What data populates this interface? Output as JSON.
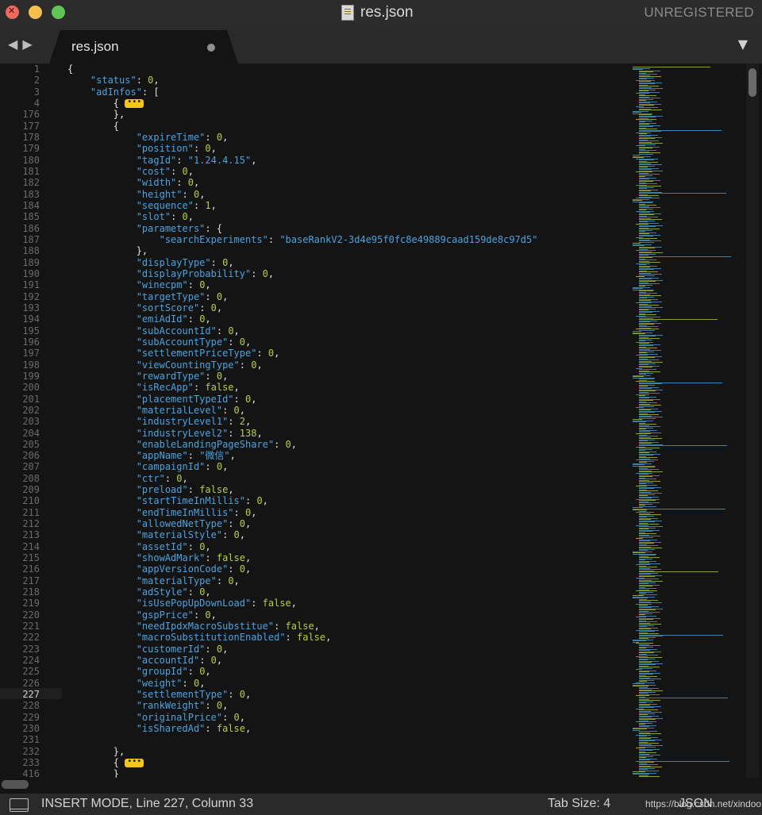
{
  "window": {
    "title": "res.json",
    "registration": "UNREGISTERED"
  },
  "tabs": [
    {
      "label": "res.json",
      "modified": true
    }
  ],
  "editor": {
    "current_line_number": 227,
    "lines": [
      {
        "n": 1,
        "indent": 0,
        "t": [
          [
            "p",
            "{"
          ]
        ]
      },
      {
        "n": 2,
        "indent": 1,
        "t": [
          [
            "k",
            "\"status\""
          ],
          [
            "p",
            ": "
          ],
          [
            "n",
            "0"
          ],
          [
            "p",
            ","
          ]
        ]
      },
      {
        "n": 3,
        "indent": 1,
        "t": [
          [
            "k",
            "\"adInfos\""
          ],
          [
            "p",
            ": ["
          ]
        ]
      },
      {
        "n": 4,
        "indent": 2,
        "t": [
          [
            "p",
            "{ "
          ],
          [
            "f",
            "•••"
          ]
        ]
      },
      {
        "n": 176,
        "indent": 2,
        "t": [
          [
            "p",
            "},"
          ]
        ]
      },
      {
        "n": 177,
        "indent": 2,
        "t": [
          [
            "p",
            "{"
          ]
        ]
      },
      {
        "n": 178,
        "indent": 3,
        "t": [
          [
            "k",
            "\"expireTime\""
          ],
          [
            "p",
            ": "
          ],
          [
            "n",
            "0"
          ],
          [
            "p",
            ","
          ]
        ]
      },
      {
        "n": 179,
        "indent": 3,
        "t": [
          [
            "k",
            "\"position\""
          ],
          [
            "p",
            ": "
          ],
          [
            "n",
            "0"
          ],
          [
            "p",
            ","
          ]
        ]
      },
      {
        "n": 180,
        "indent": 3,
        "t": [
          [
            "k",
            "\"tagId\""
          ],
          [
            "p",
            ": "
          ],
          [
            "s",
            "\"1.24.4.15\""
          ],
          [
            "p",
            ","
          ]
        ]
      },
      {
        "n": 181,
        "indent": 3,
        "t": [
          [
            "k",
            "\"cost\""
          ],
          [
            "p",
            ": "
          ],
          [
            "n",
            "0"
          ],
          [
            "p",
            ","
          ]
        ]
      },
      {
        "n": 182,
        "indent": 3,
        "t": [
          [
            "k",
            "\"width\""
          ],
          [
            "p",
            ": "
          ],
          [
            "n",
            "0"
          ],
          [
            "p",
            ","
          ]
        ]
      },
      {
        "n": 183,
        "indent": 3,
        "t": [
          [
            "k",
            "\"height\""
          ],
          [
            "p",
            ": "
          ],
          [
            "n",
            "0"
          ],
          [
            "p",
            ","
          ]
        ]
      },
      {
        "n": 184,
        "indent": 3,
        "t": [
          [
            "k",
            "\"sequence\""
          ],
          [
            "p",
            ": "
          ],
          [
            "n",
            "1"
          ],
          [
            "p",
            ","
          ]
        ]
      },
      {
        "n": 185,
        "indent": 3,
        "t": [
          [
            "k",
            "\"slot\""
          ],
          [
            "p",
            ": "
          ],
          [
            "n",
            "0"
          ],
          [
            "p",
            ","
          ]
        ]
      },
      {
        "n": 186,
        "indent": 3,
        "t": [
          [
            "k",
            "\"parameters\""
          ],
          [
            "p",
            ": {"
          ]
        ]
      },
      {
        "n": 187,
        "indent": 4,
        "t": [
          [
            "k",
            "\"searchExperiments\""
          ],
          [
            "p",
            ": "
          ],
          [
            "s",
            "\"baseRankV2-3d4e95f0fc8e49889caad159de8c97d5\""
          ]
        ]
      },
      {
        "n": 188,
        "indent": 3,
        "t": [
          [
            "p",
            "},"
          ]
        ]
      },
      {
        "n": 189,
        "indent": 3,
        "t": [
          [
            "k",
            "\"displayType\""
          ],
          [
            "p",
            ": "
          ],
          [
            "n",
            "0"
          ],
          [
            "p",
            ","
          ]
        ]
      },
      {
        "n": 190,
        "indent": 3,
        "t": [
          [
            "k",
            "\"displayProbability\""
          ],
          [
            "p",
            ": "
          ],
          [
            "n",
            "0"
          ],
          [
            "p",
            ","
          ]
        ]
      },
      {
        "n": 191,
        "indent": 3,
        "t": [
          [
            "k",
            "\"winecpm\""
          ],
          [
            "p",
            ": "
          ],
          [
            "n",
            "0"
          ],
          [
            "p",
            ","
          ]
        ]
      },
      {
        "n": 192,
        "indent": 3,
        "t": [
          [
            "k",
            "\"targetType\""
          ],
          [
            "p",
            ": "
          ],
          [
            "n",
            "0"
          ],
          [
            "p",
            ","
          ]
        ]
      },
      {
        "n": 193,
        "indent": 3,
        "t": [
          [
            "k",
            "\"sortScore\""
          ],
          [
            "p",
            ": "
          ],
          [
            "n",
            "0"
          ],
          [
            "p",
            ","
          ]
        ]
      },
      {
        "n": 194,
        "indent": 3,
        "t": [
          [
            "k",
            "\"emiAdId\""
          ],
          [
            "p",
            ": "
          ],
          [
            "n",
            "0"
          ],
          [
            "p",
            ","
          ]
        ]
      },
      {
        "n": 195,
        "indent": 3,
        "t": [
          [
            "k",
            "\"subAccountId\""
          ],
          [
            "p",
            ": "
          ],
          [
            "n",
            "0"
          ],
          [
            "p",
            ","
          ]
        ]
      },
      {
        "n": 196,
        "indent": 3,
        "t": [
          [
            "k",
            "\"subAccountType\""
          ],
          [
            "p",
            ": "
          ],
          [
            "n",
            "0"
          ],
          [
            "p",
            ","
          ]
        ]
      },
      {
        "n": 197,
        "indent": 3,
        "t": [
          [
            "k",
            "\"settlementPriceType\""
          ],
          [
            "p",
            ": "
          ],
          [
            "n",
            "0"
          ],
          [
            "p",
            ","
          ]
        ]
      },
      {
        "n": 198,
        "indent": 3,
        "t": [
          [
            "k",
            "\"viewCountingType\""
          ],
          [
            "p",
            ": "
          ],
          [
            "n",
            "0"
          ],
          [
            "p",
            ","
          ]
        ]
      },
      {
        "n": 199,
        "indent": 3,
        "t": [
          [
            "k",
            "\"rewardType\""
          ],
          [
            "p",
            ": "
          ],
          [
            "n",
            "0"
          ],
          [
            "p",
            ","
          ]
        ]
      },
      {
        "n": 200,
        "indent": 3,
        "t": [
          [
            "k",
            "\"isRecApp\""
          ],
          [
            "p",
            ": "
          ],
          [
            "b",
            "false"
          ],
          [
            "p",
            ","
          ]
        ]
      },
      {
        "n": 201,
        "indent": 3,
        "t": [
          [
            "k",
            "\"placementTypeId\""
          ],
          [
            "p",
            ": "
          ],
          [
            "n",
            "0"
          ],
          [
            "p",
            ","
          ]
        ]
      },
      {
        "n": 202,
        "indent": 3,
        "t": [
          [
            "k",
            "\"materialLevel\""
          ],
          [
            "p",
            ": "
          ],
          [
            "n",
            "0"
          ],
          [
            "p",
            ","
          ]
        ]
      },
      {
        "n": 203,
        "indent": 3,
        "t": [
          [
            "k",
            "\"industryLevel1\""
          ],
          [
            "p",
            ": "
          ],
          [
            "n",
            "2"
          ],
          [
            "p",
            ","
          ]
        ]
      },
      {
        "n": 204,
        "indent": 3,
        "t": [
          [
            "k",
            "\"industryLevel2\""
          ],
          [
            "p",
            ": "
          ],
          [
            "n",
            "138"
          ],
          [
            "p",
            ","
          ]
        ]
      },
      {
        "n": 205,
        "indent": 3,
        "t": [
          [
            "k",
            "\"enableLandingPageShare\""
          ],
          [
            "p",
            ": "
          ],
          [
            "n",
            "0"
          ],
          [
            "p",
            ","
          ]
        ]
      },
      {
        "n": 206,
        "indent": 3,
        "t": [
          [
            "k",
            "\"appName\""
          ],
          [
            "p",
            ": "
          ],
          [
            "s",
            "\"微信\""
          ],
          [
            "p",
            ","
          ]
        ]
      },
      {
        "n": 207,
        "indent": 3,
        "t": [
          [
            "k",
            "\"campaignId\""
          ],
          [
            "p",
            ": "
          ],
          [
            "n",
            "0"
          ],
          [
            "p",
            ","
          ]
        ]
      },
      {
        "n": 208,
        "indent": 3,
        "t": [
          [
            "k",
            "\"ctr\""
          ],
          [
            "p",
            ": "
          ],
          [
            "n",
            "0"
          ],
          [
            "p",
            ","
          ]
        ]
      },
      {
        "n": 209,
        "indent": 3,
        "t": [
          [
            "k",
            "\"preload\""
          ],
          [
            "p",
            ": "
          ],
          [
            "b",
            "false"
          ],
          [
            "p",
            ","
          ]
        ]
      },
      {
        "n": 210,
        "indent": 3,
        "t": [
          [
            "k",
            "\"startTimeInMillis\""
          ],
          [
            "p",
            ": "
          ],
          [
            "n",
            "0"
          ],
          [
            "p",
            ","
          ]
        ]
      },
      {
        "n": 211,
        "indent": 3,
        "t": [
          [
            "k",
            "\"endTimeInMillis\""
          ],
          [
            "p",
            ": "
          ],
          [
            "n",
            "0"
          ],
          [
            "p",
            ","
          ]
        ]
      },
      {
        "n": 212,
        "indent": 3,
        "t": [
          [
            "k",
            "\"allowedNetType\""
          ],
          [
            "p",
            ": "
          ],
          [
            "n",
            "0"
          ],
          [
            "p",
            ","
          ]
        ]
      },
      {
        "n": 213,
        "indent": 3,
        "t": [
          [
            "k",
            "\"materialStyle\""
          ],
          [
            "p",
            ": "
          ],
          [
            "n",
            "0"
          ],
          [
            "p",
            ","
          ]
        ]
      },
      {
        "n": 214,
        "indent": 3,
        "t": [
          [
            "k",
            "\"assetId\""
          ],
          [
            "p",
            ": "
          ],
          [
            "n",
            "0"
          ],
          [
            "p",
            ","
          ]
        ]
      },
      {
        "n": 215,
        "indent": 3,
        "t": [
          [
            "k",
            "\"showAdMark\""
          ],
          [
            "p",
            ": "
          ],
          [
            "b",
            "false"
          ],
          [
            "p",
            ","
          ]
        ]
      },
      {
        "n": 216,
        "indent": 3,
        "t": [
          [
            "k",
            "\"appVersionCode\""
          ],
          [
            "p",
            ": "
          ],
          [
            "n",
            "0"
          ],
          [
            "p",
            ","
          ]
        ]
      },
      {
        "n": 217,
        "indent": 3,
        "t": [
          [
            "k",
            "\"materialType\""
          ],
          [
            "p",
            ": "
          ],
          [
            "n",
            "0"
          ],
          [
            "p",
            ","
          ]
        ]
      },
      {
        "n": 218,
        "indent": 3,
        "t": [
          [
            "k",
            "\"adStyle\""
          ],
          [
            "p",
            ": "
          ],
          [
            "n",
            "0"
          ],
          [
            "p",
            ","
          ]
        ]
      },
      {
        "n": 219,
        "indent": 3,
        "t": [
          [
            "k",
            "\"isUsePopUpDownLoad\""
          ],
          [
            "p",
            ": "
          ],
          [
            "b",
            "false"
          ],
          [
            "p",
            ","
          ]
        ]
      },
      {
        "n": 220,
        "indent": 3,
        "t": [
          [
            "k",
            "\"gspPrice\""
          ],
          [
            "p",
            ": "
          ],
          [
            "n",
            "0"
          ],
          [
            "p",
            ","
          ]
        ]
      },
      {
        "n": 221,
        "indent": 3,
        "t": [
          [
            "k",
            "\"needIpdxMacroSubstitue\""
          ],
          [
            "p",
            ": "
          ],
          [
            "b",
            "false"
          ],
          [
            "p",
            ","
          ]
        ]
      },
      {
        "n": 222,
        "indent": 3,
        "t": [
          [
            "k",
            "\"macroSubstitutionEnabled\""
          ],
          [
            "p",
            ": "
          ],
          [
            "b",
            "false"
          ],
          [
            "p",
            ","
          ]
        ]
      },
      {
        "n": 223,
        "indent": 3,
        "t": [
          [
            "k",
            "\"customerId\""
          ],
          [
            "p",
            ": "
          ],
          [
            "n",
            "0"
          ],
          [
            "p",
            ","
          ]
        ]
      },
      {
        "n": 224,
        "indent": 3,
        "t": [
          [
            "k",
            "\"accountId\""
          ],
          [
            "p",
            ": "
          ],
          [
            "n",
            "0"
          ],
          [
            "p",
            ","
          ]
        ]
      },
      {
        "n": 225,
        "indent": 3,
        "t": [
          [
            "k",
            "\"groupId\""
          ],
          [
            "p",
            ": "
          ],
          [
            "n",
            "0"
          ],
          [
            "p",
            ","
          ]
        ]
      },
      {
        "n": 226,
        "indent": 3,
        "t": [
          [
            "k",
            "\"weight\""
          ],
          [
            "p",
            ": "
          ],
          [
            "n",
            "0"
          ],
          [
            "p",
            ","
          ]
        ]
      },
      {
        "n": 227,
        "indent": 3,
        "t": [
          [
            "k",
            "\"settlementType\""
          ],
          [
            "p",
            ": "
          ],
          [
            "n",
            "0"
          ],
          [
            "p",
            ","
          ]
        ]
      },
      {
        "n": 228,
        "indent": 3,
        "t": [
          [
            "k",
            "\"rankWeight\""
          ],
          [
            "p",
            ": "
          ],
          [
            "n",
            "0"
          ],
          [
            "p",
            ","
          ]
        ]
      },
      {
        "n": 229,
        "indent": 3,
        "t": [
          [
            "k",
            "\"originalPrice\""
          ],
          [
            "p",
            ": "
          ],
          [
            "n",
            "0"
          ],
          [
            "p",
            ","
          ]
        ]
      },
      {
        "n": 230,
        "indent": 3,
        "t": [
          [
            "k",
            "\"isSharedAd\""
          ],
          [
            "p",
            ": "
          ],
          [
            "b",
            "false"
          ],
          [
            "p",
            ","
          ]
        ]
      },
      {
        "n": 231,
        "indent": 0,
        "t": []
      },
      {
        "n": 232,
        "indent": 2,
        "t": [
          [
            "p",
            "},"
          ]
        ]
      },
      {
        "n": 233,
        "indent": 2,
        "t": [
          [
            "p",
            "{ "
          ],
          [
            "f",
            "•••"
          ]
        ]
      },
      {
        "n": 416,
        "indent": 2,
        "t": [
          [
            "p",
            "}"
          ]
        ]
      }
    ]
  },
  "status_bar": {
    "mode": "INSERT MODE, Line 227, Column 33",
    "tab_size": "Tab Size: 4",
    "syntax": "JSON",
    "watermark": "https://blog.csdn.net/xindoo"
  },
  "colors": {
    "key": "#4aa3e0",
    "number": "#b6cf3a",
    "punct": "#e0e0e0",
    "fold_marker": "#f5c518",
    "background": "#141414"
  },
  "icons": [
    "close-window-icon",
    "minimize-window-icon",
    "zoom-window-icon",
    "json-file-icon",
    "back-arrow-icon",
    "forward-arrow-icon",
    "tab-dropdown-icon",
    "panel-toggle-icon"
  ]
}
